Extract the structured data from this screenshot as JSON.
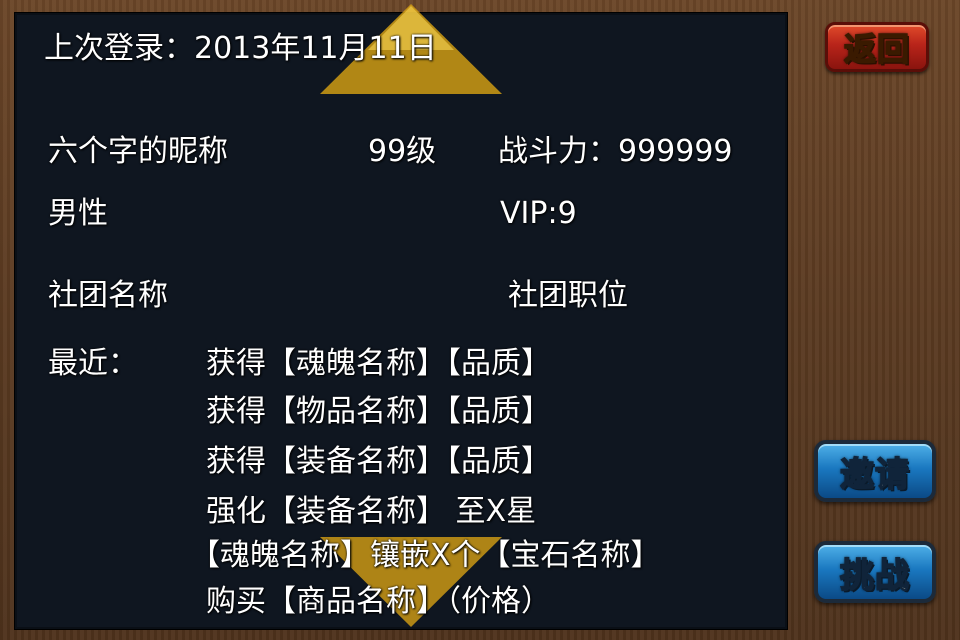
{
  "header": {
    "last_login": "上次登录：2013年11月11日"
  },
  "profile": {
    "nickname": "六个字的昵称",
    "level": "99级",
    "power": "战斗力：999999",
    "gender": "男性",
    "vip": "VIP:9",
    "guild_name": "社团名称",
    "guild_position": "社团职位"
  },
  "recent": {
    "label": "最近：",
    "items": [
      "获得【魂魄名称】【品质】",
      "获得【物品名称】【品质】",
      "获得【装备名称】【品质】",
      "强化【装备名称】 至X星",
      "【魂魄名称】镶嵌X个【宝石名称】",
      "购买【商品名称】（价格）"
    ]
  },
  "buttons": {
    "back": "返回",
    "invite": "邀请",
    "challenge": "挑战"
  },
  "colors": {
    "panel_bg": "#0f1620",
    "frame_wood": "#5a3a22",
    "arrow_gold": "#d6a014",
    "back_button": "#b8241a",
    "action_button": "#1a78c0"
  }
}
